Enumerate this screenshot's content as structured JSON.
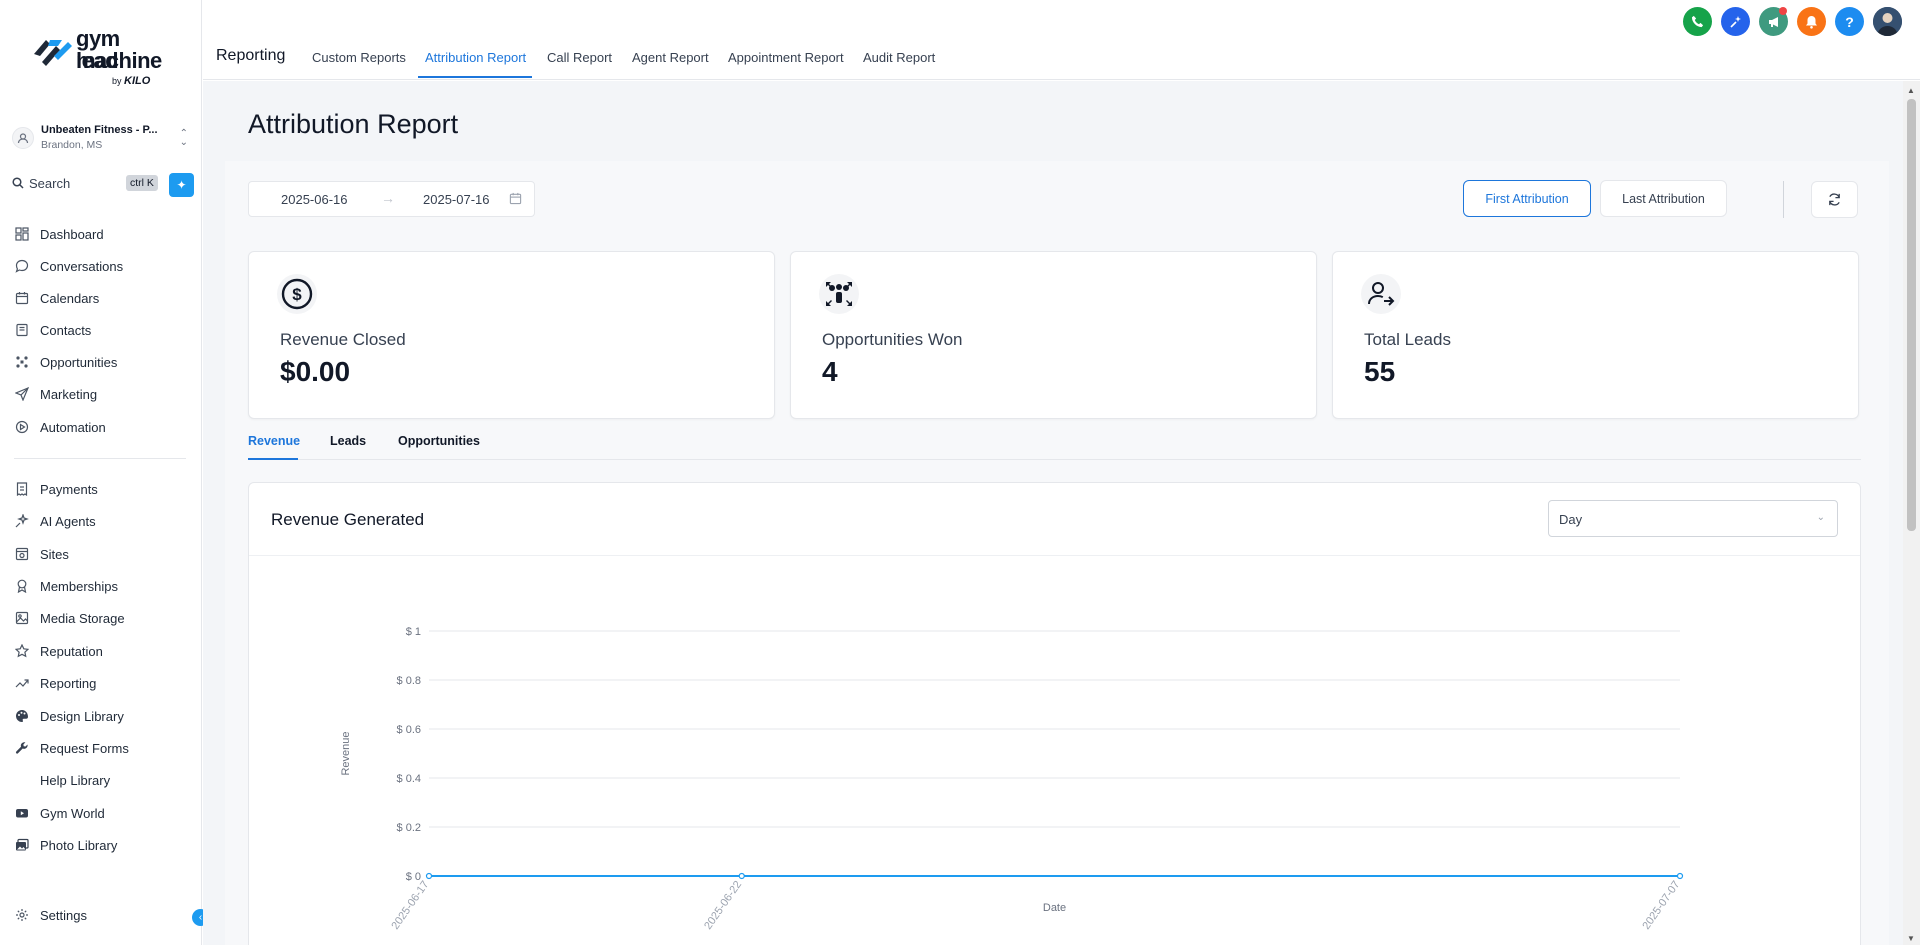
{
  "app": {
    "logo": {
      "line1": "gym lead",
      "line2": "machine",
      "by": "by",
      "brand": "KILO"
    },
    "location": {
      "name": "Unbeaten Fitness - P...",
      "city": "Brandon, MS"
    },
    "search": {
      "label": "Search",
      "shortcut": "ctrl K"
    }
  },
  "sidebar": {
    "items": [
      {
        "label": "Dashboard",
        "icon": "dashboard-icon"
      },
      {
        "label": "Conversations",
        "icon": "chat-icon"
      },
      {
        "label": "Calendars",
        "icon": "calendar-icon"
      },
      {
        "label": "Contacts",
        "icon": "contacts-icon"
      },
      {
        "label": "Opportunities",
        "icon": "opportunities-icon"
      },
      {
        "label": "Marketing",
        "icon": "send-icon"
      },
      {
        "label": "Automation",
        "icon": "automation-icon"
      },
      {
        "label": "Payments",
        "icon": "receipt-icon"
      },
      {
        "label": "AI Agents",
        "icon": "sparkle-icon"
      },
      {
        "label": "Sites",
        "icon": "sites-icon"
      },
      {
        "label": "Memberships",
        "icon": "award-icon"
      },
      {
        "label": "Media Storage",
        "icon": "image-icon"
      },
      {
        "label": "Reputation",
        "icon": "star-icon"
      },
      {
        "label": "Reporting",
        "icon": "trend-icon"
      },
      {
        "label": "Design Library",
        "icon": "palette-icon"
      },
      {
        "label": "Request Forms",
        "icon": "wrench-icon"
      },
      {
        "label": "Help Library",
        "icon": ""
      },
      {
        "label": "Gym World",
        "icon": "youtube-icon"
      },
      {
        "label": "Photo Library",
        "icon": "photos-icon"
      }
    ],
    "settings": "Settings"
  },
  "header": {
    "section": "Reporting",
    "tabs": [
      "Custom Reports",
      "Attribution Report",
      "Call Report",
      "Agent Report",
      "Appointment Report",
      "Audit Report"
    ],
    "active_tab": "Attribution Report",
    "icons": [
      {
        "name": "phone-icon",
        "color": "#16a34a"
      },
      {
        "name": "magic-icon",
        "color": "#2563eb"
      },
      {
        "name": "megaphone-icon",
        "color": "#3f9a7f"
      },
      {
        "name": "bell-icon",
        "color": "#f97316"
      },
      {
        "name": "help-icon",
        "color": "#1d8cf0"
      }
    ]
  },
  "page": {
    "title": "Attribution Report",
    "date_start": "2025-06-16",
    "date_end": "2025-07-16",
    "first_attribution": "First Attribution",
    "last_attribution": "Last Attribution",
    "cards": [
      {
        "label": "Revenue Closed",
        "value": "$0.00",
        "icon": "dollar-circle-icon"
      },
      {
        "label": "Opportunities Won",
        "value": "4",
        "icon": "team-arrows-icon"
      },
      {
        "label": "Total Leads",
        "value": "55",
        "icon": "user-arrow-icon"
      }
    ],
    "subtabs": [
      "Revenue",
      "Leads",
      "Opportunities"
    ],
    "chart_title": "Revenue Generated",
    "granularity": "Day"
  },
  "chart_data": {
    "type": "line",
    "title": "Revenue Generated",
    "xlabel": "Date",
    "ylabel": "Revenue",
    "x": [
      "2025-06-17",
      "2025-06-22",
      "2025-07-07"
    ],
    "y_ticks": [
      "$ 0",
      "$ 0.2",
      "$ 0.4",
      "$ 0.6",
      "$ 0.8",
      "$ 1"
    ],
    "ylim": [
      0,
      1
    ],
    "series": [
      {
        "values": [
          0,
          0,
          0
        ],
        "color": "#1d9bf0"
      }
    ],
    "grid": true
  }
}
